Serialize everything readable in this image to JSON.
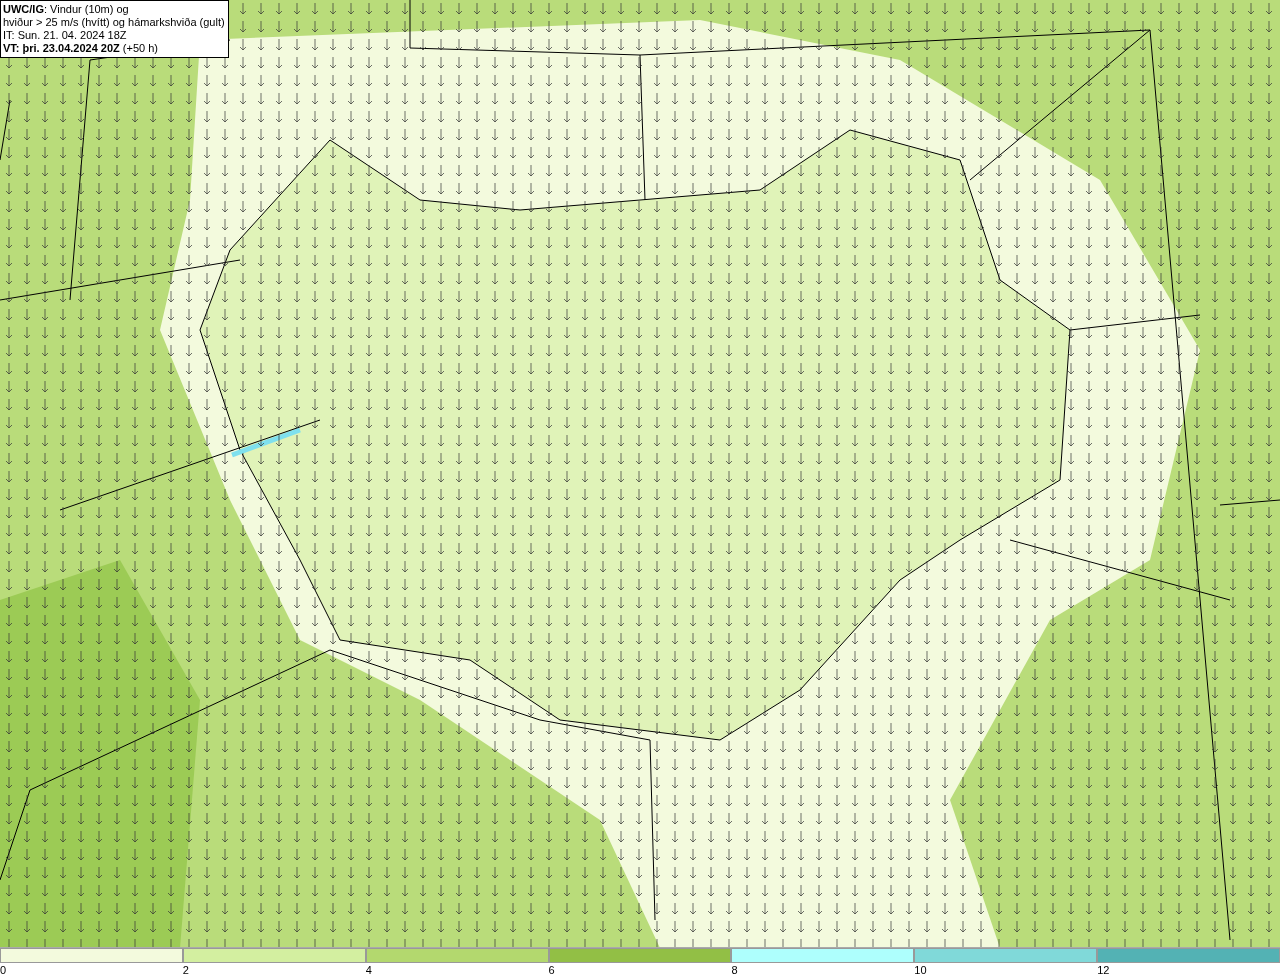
{
  "info_box": {
    "lines": [
      "**UWC/IG**: Vindur (10m) og",
      "hviður > 25 m/s (hvítt) og hámarkshviða (gult)",
      "IT: Sun. 21. 04. 2024 18Z",
      "**VT: þri. 23.04.2024 20Z** (+50 h)"
    ]
  },
  "legend": {
    "segments": [
      {
        "label": "0",
        "color": "#f3fadd"
      },
      {
        "label": "2",
        "color": "#d3efa0"
      },
      {
        "label": "4",
        "color": "#b3d86e"
      },
      {
        "label": "6",
        "color": "#92bf45"
      },
      {
        "label": "8",
        "color": "#aefffd"
      },
      {
        "label": "10",
        "color": "#80d9d9"
      },
      {
        "label": "12",
        "color": "#53b2b4"
      }
    ]
  }
}
